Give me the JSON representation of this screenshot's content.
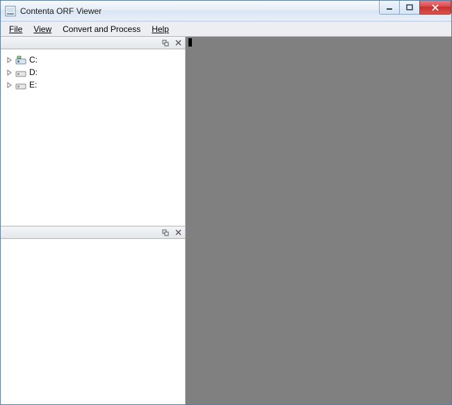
{
  "window": {
    "title": "Contenta ORF Viewer"
  },
  "menu": {
    "file": "File",
    "view": "View",
    "convert": "Convert and Process",
    "help": "Help"
  },
  "tree": {
    "items": [
      {
        "label": "C:",
        "icon": "system-drive"
      },
      {
        "label": "D:",
        "icon": "drive"
      },
      {
        "label": "E:",
        "icon": "drive"
      }
    ]
  }
}
